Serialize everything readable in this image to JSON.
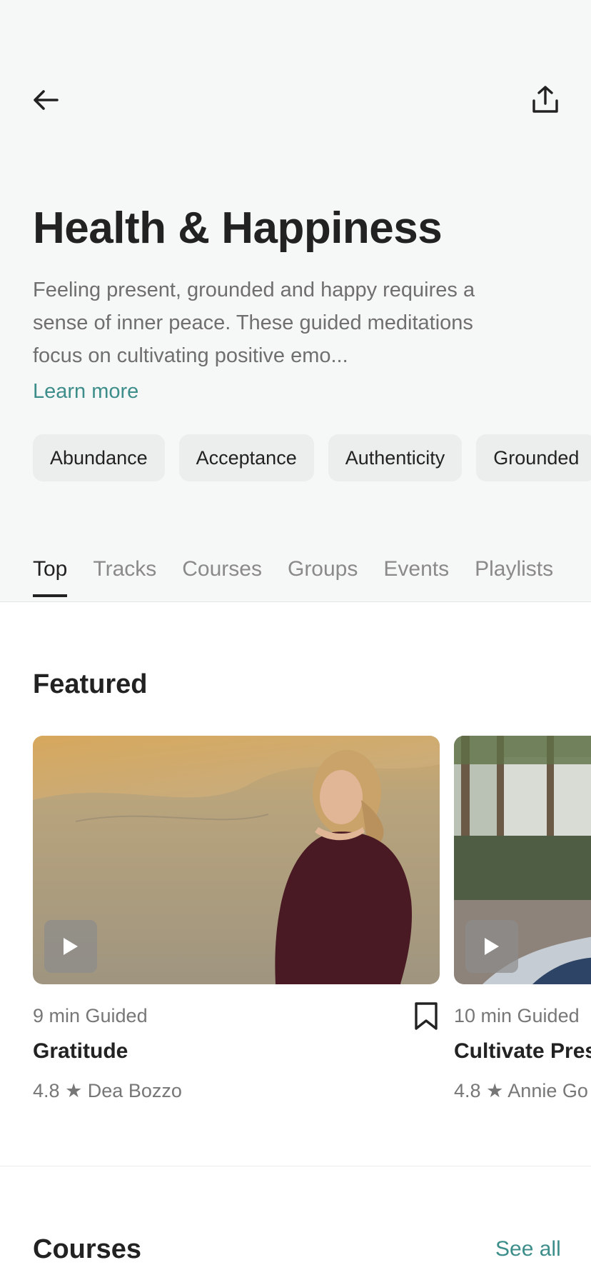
{
  "header": {
    "back_icon": "arrow-left-icon",
    "share_icon": "share-upload-icon"
  },
  "topic": {
    "title": "Health & Happiness",
    "description": "Feeling present, grounded and happy requires a sense of inner peace. These guided meditations focus on cultivating positive emo...",
    "learn_more": "Learn more",
    "accent_color": "#3d8e8a"
  },
  "tags": [
    "Abundance",
    "Acceptance",
    "Authenticity",
    "Grounded"
  ],
  "tabs": [
    {
      "label": "Top",
      "active": true
    },
    {
      "label": "Tracks",
      "active": false
    },
    {
      "label": "Courses",
      "active": false
    },
    {
      "label": "Groups",
      "active": false
    },
    {
      "label": "Events",
      "active": false
    },
    {
      "label": "Playlists",
      "active": false
    }
  ],
  "featured": {
    "title": "Featured",
    "cards": [
      {
        "meta": "9 min Guided",
        "title": "Gratitude",
        "rating": "4.8",
        "author": "Dea Bozzo",
        "bookmark_icon": "bookmark-icon",
        "play_icon": "play-icon"
      },
      {
        "meta": "10 min Guided",
        "title": "Cultivate Pres",
        "rating": "4.8",
        "author": "Annie Go",
        "play_icon": "play-icon"
      }
    ]
  },
  "courses": {
    "title": "Courses",
    "see_all": "See all"
  }
}
